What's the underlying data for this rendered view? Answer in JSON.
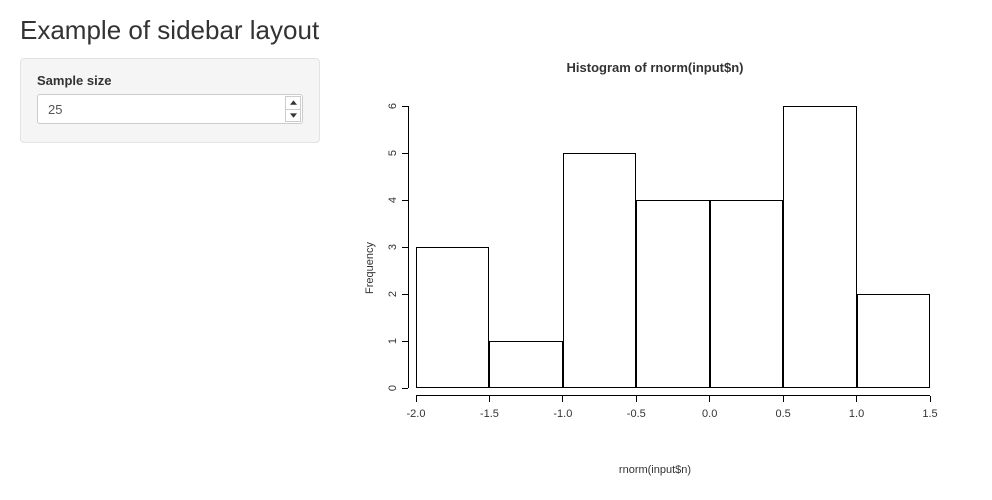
{
  "page": {
    "title": "Example of sidebar layout"
  },
  "sidebar": {
    "sample_size_label": "Sample size",
    "sample_size_value": "25"
  },
  "chart_data": {
    "type": "bar",
    "title": "Histogram of rnorm(input$n)",
    "xlabel": "rnorm(input$n)",
    "ylabel": "Frequency",
    "xlim": [
      -2.0,
      1.5
    ],
    "ylim": [
      0,
      6
    ],
    "xticks": [
      -2.0,
      -1.5,
      -1.0,
      -0.5,
      0.0,
      0.5,
      1.0,
      1.5
    ],
    "yticks": [
      0,
      1,
      2,
      3,
      4,
      5,
      6
    ],
    "bin_edges": [
      -2.0,
      -1.5,
      -1.0,
      -0.5,
      0.0,
      0.5,
      1.0,
      1.5
    ],
    "values": [
      3,
      1,
      5,
      4,
      4,
      6,
      2
    ],
    "xtick_labels": [
      "-2.0",
      "-1.5",
      "-1.0",
      "-0.5",
      "0.0",
      "0.5",
      "1.0",
      "1.5"
    ],
    "ytick_labels": [
      "0",
      "1",
      "2",
      "3",
      "4",
      "5",
      "6"
    ]
  }
}
